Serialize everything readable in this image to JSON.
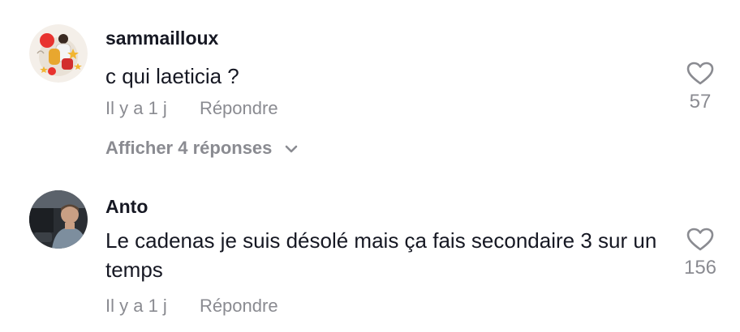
{
  "comments": [
    {
      "username": "sammailloux",
      "text": "c qui laeticia ?",
      "time": "Il y a 1 j",
      "reply_label": "Répondre",
      "likes": "57",
      "replies_label": "Afficher 4 réponses",
      "avatar_icon": "avatar-illustration-basketball",
      "heart_icon": "heart-outline-icon",
      "chevron_icon": "chevron-down-icon"
    },
    {
      "username": "Anto",
      "text": "Le cadenas je suis désolé mais ça fais secondaire 3 sur un temps",
      "time": "Il y a 1 j",
      "reply_label": "Répondre",
      "likes": "156",
      "avatar_icon": "avatar-photo-man-in-car",
      "heart_icon": "heart-outline-icon"
    }
  ],
  "colors": {
    "primary_text": "#161823",
    "secondary_text": "#8a8b91",
    "background": "#ffffff"
  }
}
